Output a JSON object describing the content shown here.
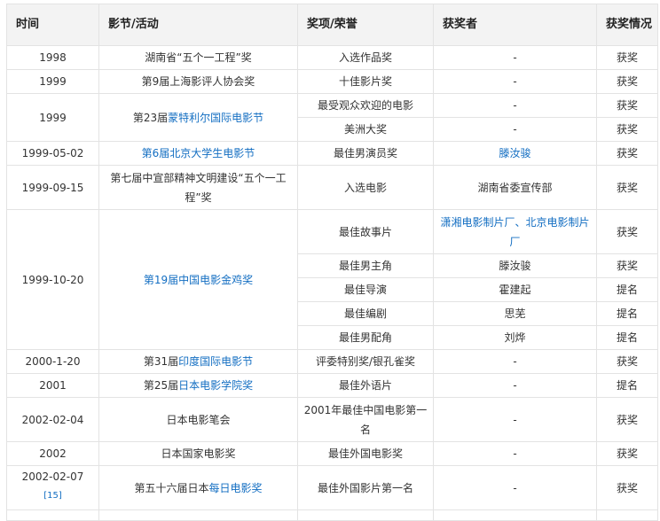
{
  "headers": {
    "time": "时间",
    "festival": "影节/活动",
    "award": "奖项/荣誉",
    "winner": "获奖者",
    "result": "获奖情况"
  },
  "colors": {
    "link": "#136ec2",
    "header_bg": "#f3f3f3",
    "border": "#e3e3e3",
    "text": "#333333"
  },
  "rows": [
    {
      "time": "1998",
      "festival": {
        "pre": "湖南省“五个一工程”奖",
        "link": "",
        "post": ""
      },
      "award": "入选作品奖",
      "winner": "-",
      "result": "获奖"
    },
    {
      "time": "1999",
      "festival": {
        "pre": "第9届上海影评人协会奖",
        "link": "",
        "post": ""
      },
      "award": "十佳影片奖",
      "winner": "-",
      "result": "获奖"
    },
    {
      "time": "1999",
      "festival": {
        "pre": "第23届",
        "link": "蒙特利尔国际电影节",
        "post": ""
      },
      "award": "最受观众欢迎的电影",
      "winner": "-",
      "result": "获奖"
    },
    {
      "award": "美洲大奖",
      "winner": "-",
      "result": "获奖"
    },
    {
      "time": "1999-05-02",
      "festival": {
        "pre": "",
        "link": "第6届北京大学生电影节",
        "post": ""
      },
      "award": "最佳男演员奖",
      "winner": "滕汝骏",
      "result": "获奖"
    },
    {
      "time": "1999-09-15",
      "festival": {
        "pre": "第七届中宣部精神文明建设“五个一工程”奖",
        "link": "",
        "post": ""
      },
      "award": "入选电影",
      "winner": "湖南省委宣传部",
      "result": "获奖"
    },
    {
      "time": "1999-10-20",
      "festival": {
        "pre": "",
        "link": "第19届中国电影金鸡奖",
        "post": ""
      },
      "award": "最佳故事片",
      "winner": "潇湘电影制片厂、北京电影制片厂",
      "result": "获奖"
    },
    {
      "award": "最佳男主角",
      "winner": "滕汝骏",
      "result": "获奖"
    },
    {
      "award": "最佳导演",
      "winner": "霍建起",
      "result": "提名"
    },
    {
      "award": "最佳编剧",
      "winner": "思芜",
      "result": "提名"
    },
    {
      "award": "最佳男配角",
      "winner": "刘烨",
      "result": "提名"
    },
    {
      "time": "2000-1-20",
      "festival": {
        "pre": "第31届",
        "link": "印度国际电影节",
        "post": ""
      },
      "award": "评委特别奖/银孔雀奖",
      "winner": "-",
      "result": "获奖"
    },
    {
      "time": "2001",
      "festival": {
        "pre": "第25届",
        "link": "日本电影学院奖",
        "post": ""
      },
      "award": "最佳外语片",
      "winner": "-",
      "result": "提名"
    },
    {
      "time": "2002-02-04",
      "festival": {
        "pre": "日本电影笔会",
        "link": "",
        "post": ""
      },
      "award": "2001年最佳中国电影第一名",
      "winner": "-",
      "result": "获奖"
    },
    {
      "time": "2002",
      "festival": {
        "pre": "日本国家电影奖",
        "link": "",
        "post": ""
      },
      "award": "最佳外国电影奖",
      "winner": "-",
      "result": "获奖"
    },
    {
      "time": "2002-02-07",
      "ref": "[15]",
      "festival": {
        "pre": "第五十六届日本",
        "link": "每日电影奖",
        "post": ""
      },
      "award": "最佳外国影片第一名",
      "winner": "-",
      "result": "获奖"
    }
  ]
}
